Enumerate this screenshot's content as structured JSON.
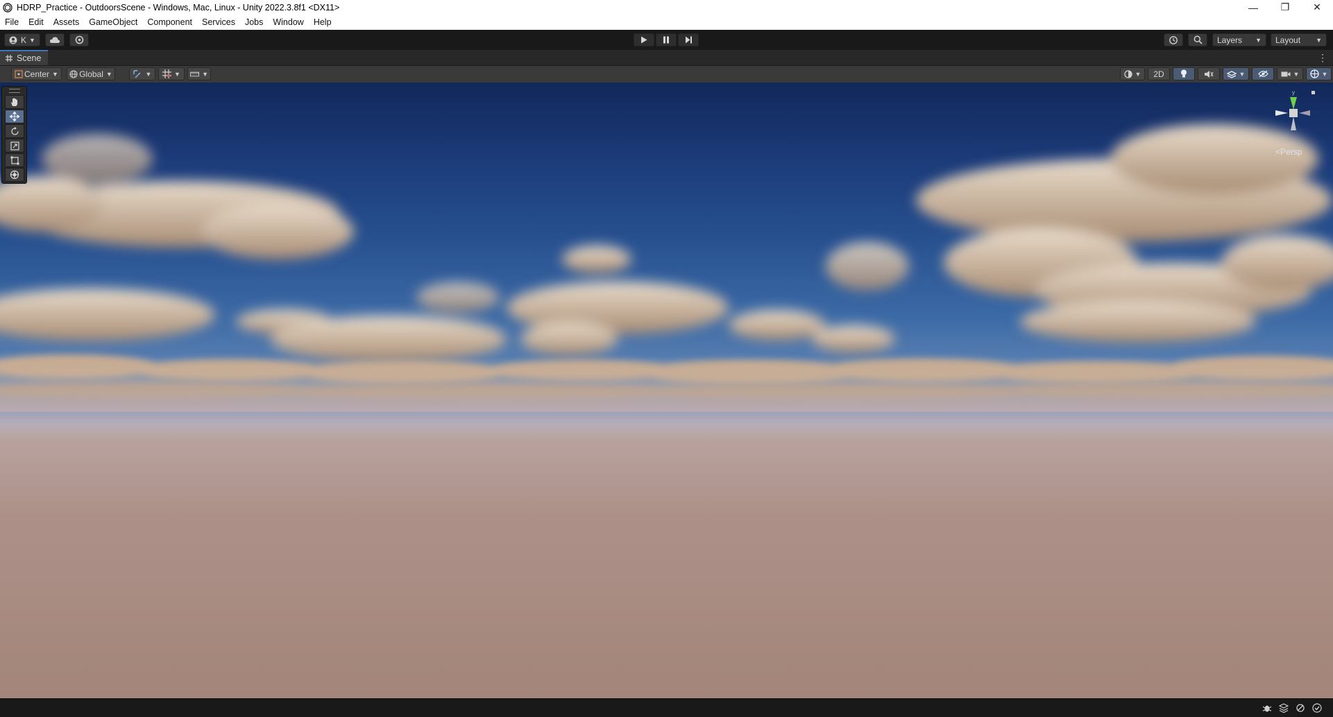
{
  "window": {
    "title": "HDRP_Practice - OutdoorsScene - Windows, Mac, Linux - Unity 2022.3.8f1 <DX11>",
    "minimize": "—",
    "restore": "❐",
    "close": "✕"
  },
  "menu": [
    "File",
    "Edit",
    "Assets",
    "GameObject",
    "Component",
    "Services",
    "Jobs",
    "Window",
    "Help"
  ],
  "toolbar": {
    "account_label": "K",
    "layers_label": "Layers",
    "layout_label": "Layout"
  },
  "scene_tab": {
    "label": "Scene"
  },
  "scene_toolbar": {
    "pivot_label": "Center",
    "space_label": "Global",
    "mode_2d_label": "2D"
  },
  "viewport": {
    "projection_label": "Persp",
    "gizmo_axis_label": "y"
  },
  "colors": {
    "sky_top": "#12285a",
    "ground": "#a38579",
    "accent": "#3a79bb"
  },
  "icons": {
    "play": "play-icon",
    "pause": "pause-icon",
    "step": "step-icon",
    "search": "search-icon",
    "history": "history-icon"
  }
}
